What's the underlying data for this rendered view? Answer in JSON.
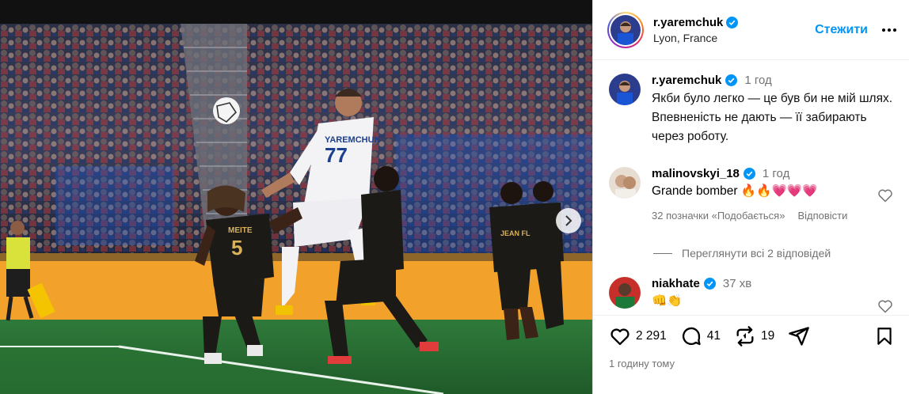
{
  "post": {
    "username": "r.yaremchuk",
    "location": "Lyon, France",
    "follow_label": "Стежити",
    "caption_time": "1 год",
    "caption": "Якби було легко — це був би не мій шлях. Впевненість не дають — її забирають через роботу."
  },
  "comments": [
    {
      "username": "malinovskyi_18",
      "time": "1 год",
      "text": "Grande bomber 🔥🔥💗💗💗",
      "likes": "32 позначки «Подобається»",
      "reply": "Відповісти",
      "view_replies": "Переглянути всі 2 відповідей"
    },
    {
      "username": "niakhate",
      "time": "37 хв",
      "text": "👊👏"
    }
  ],
  "actions": {
    "likes": "2 291",
    "comments": "41",
    "reposts": "19"
  },
  "posted_ago": "1 годину тому",
  "photo": {
    "jersey_front": "YAREMCHUK",
    "jersey_front_number": "77",
    "jersey_back_name": "MEITE",
    "jersey_back_number": "5",
    "sponsor": "JEAN FLOCH"
  },
  "colors": {
    "accent": "#0095f6",
    "verified": "#0095f6",
    "muted": "#737373"
  }
}
